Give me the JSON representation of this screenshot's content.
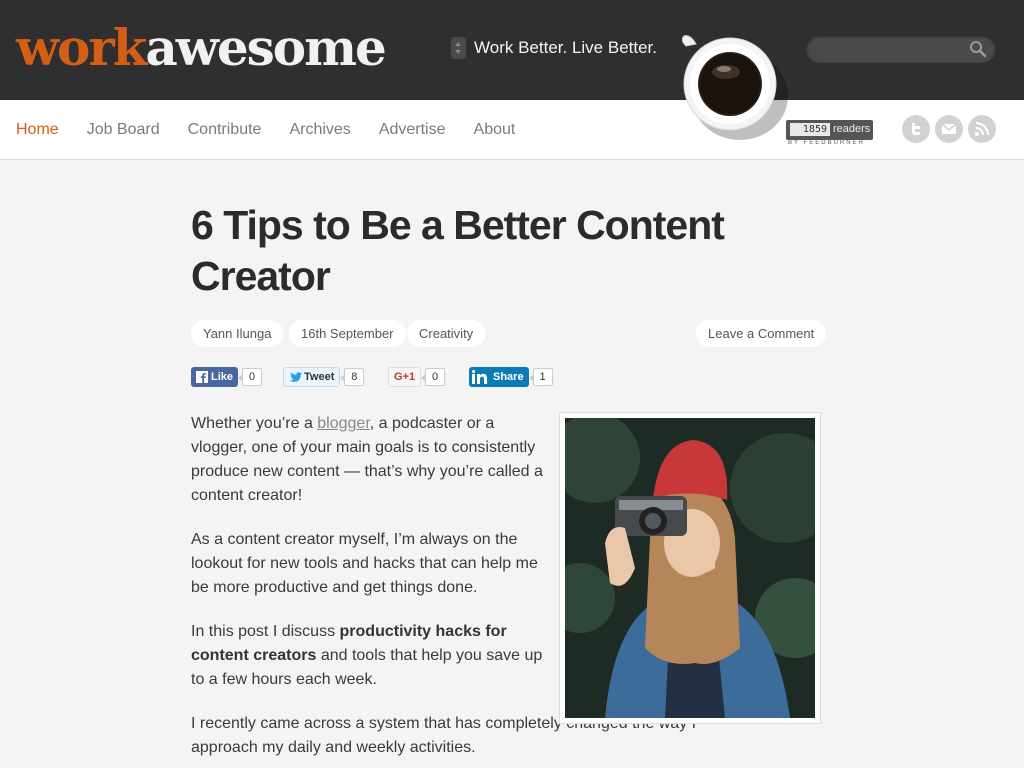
{
  "header": {
    "logo_work": "work",
    "logo_awesome": "awesome",
    "tagline": "Work Better. Live Better.",
    "search_placeholder": ""
  },
  "nav": {
    "items": [
      "Home",
      "Job Board",
      "Contribute",
      "Archives",
      "Advertise",
      "About"
    ],
    "active": "Home"
  },
  "feedburner": {
    "count": "1859",
    "label": "readers",
    "by": "BY FEEDBURNER"
  },
  "social_icons": [
    "twitter-icon",
    "email-icon",
    "rss-icon"
  ],
  "article": {
    "title": "6 Tips to Be a Better Content Creator",
    "author": "Yann Ilunga",
    "date": "16th September",
    "category": "Creativity",
    "comment_link": "Leave a Comment",
    "share": {
      "facebook": {
        "label": "Like",
        "count": "0"
      },
      "twitter": {
        "label": "Tweet",
        "count": "8"
      },
      "google": {
        "label": "G+1",
        "count": "0"
      },
      "linkedin": {
        "label": "Share",
        "count": "1"
      }
    },
    "p1_before": "Whether you’re a ",
    "p1_link": "blogger",
    "p1_after": ", a podcaster or a vlogger, one of your main goals is to consistently produce new content — that’s why you’re called a content creator!",
    "p2": "As a content creator myself, I’m always on the lookout for new tools and hacks that can help me be more productive and get things done.",
    "p3_before": "In this post I discuss ",
    "p3_bold": "productivity hacks for content creators",
    "p3_after": " and tools that help you save up to a few hours each week.",
    "p4": "I recently came across a system that has completely changed the way I approach my daily and weekly activities."
  },
  "colors": {
    "accent": "#d45e15",
    "header_bg": "#2f2f2f",
    "page_bg": "#f4f4f4"
  }
}
